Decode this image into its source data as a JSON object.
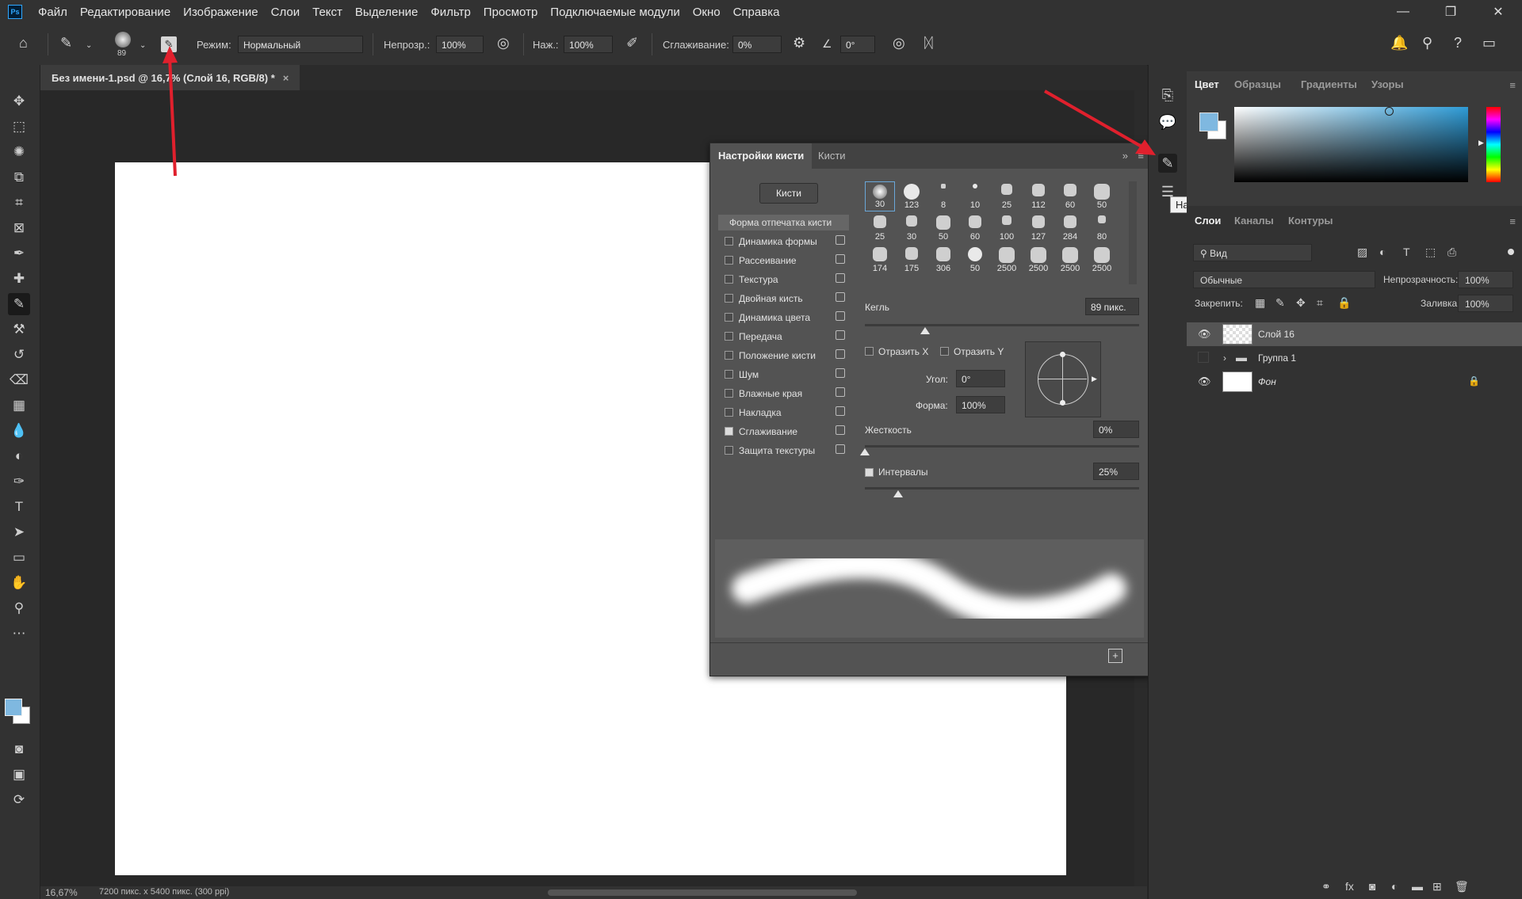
{
  "menubar": {
    "logo": "Ps",
    "items": [
      "Файл",
      "Редактирование",
      "Изображение",
      "Слои",
      "Текст",
      "Выделение",
      "Фильтр",
      "Просмотр",
      "Подключаемые модули",
      "Окно",
      "Справка"
    ],
    "minimize": "—",
    "restore": "❐",
    "close": "✕"
  },
  "options": {
    "brush_size": "89",
    "mode_label": "Режим:",
    "mode_value": "Нормальный",
    "opacity_label": "Непрозр.:",
    "opacity_value": "100%",
    "pressure_label": "Наж.:",
    "pressure_value": "100%",
    "smoothing_label": "Сглаживание:",
    "smoothing_value": "0%",
    "angle_value": "0°"
  },
  "document": {
    "tab_title": "Без имени-1.psd @ 16,7% (Слой 16, RGB/8) *",
    "zoom": "16,67%",
    "info": "7200 пикс. x 5400 пикс. (300 ppi)"
  },
  "brush_panel": {
    "tab_settings": "Настройки кисти",
    "tab_brushes": "Кисти",
    "brushes_button": "Кисти",
    "items": [
      {
        "label": "Форма отпечатка кисти",
        "checked": false,
        "header": true
      },
      {
        "label": "Динамика формы",
        "checked": false
      },
      {
        "label": "Рассеивание",
        "checked": false
      },
      {
        "label": "Текстура",
        "checked": false
      },
      {
        "label": "Двойная кисть",
        "checked": false
      },
      {
        "label": "Динамика цвета",
        "checked": false
      },
      {
        "label": "Передача",
        "checked": false
      },
      {
        "label": "Положение кисти",
        "checked": false
      },
      {
        "label": "Шум",
        "checked": false
      },
      {
        "label": "Влажные края",
        "checked": false
      },
      {
        "label": "Накладка",
        "checked": false
      },
      {
        "label": "Сглаживание",
        "checked": true
      },
      {
        "label": "Защита текстуры",
        "checked": false
      }
    ],
    "tips": [
      "30",
      "123",
      "8",
      "10",
      "25",
      "112",
      "60",
      "50",
      "25",
      "30",
      "50",
      "60",
      "100",
      "127",
      "284",
      "80",
      "174",
      "175",
      "306",
      "50",
      "2500",
      "2500",
      "2500",
      "2500"
    ],
    "size_label": "Кегль",
    "size_value": "89 пикс.",
    "size_fraction": 0.22,
    "flip_x": "Отразить X",
    "flip_y": "Отразить Y",
    "angle_label": "Угол:",
    "angle_value": "0°",
    "roundness_label": "Форма:",
    "roundness_value": "100%",
    "hardness_label": "Жесткость",
    "hardness_value": "0%",
    "hardness_fraction": 0,
    "spacing_label": "Интервалы",
    "spacing_value": "25%",
    "spacing_fraction": 0.12,
    "spacing_checked": true
  },
  "tooltip": "Настройки кисти",
  "color_panel": {
    "tabs": [
      "Цвет",
      "Образцы",
      "Градиенты",
      "Узоры"
    ],
    "foreground": "#7fb8e0",
    "background": "#ffffff"
  },
  "layers_panel": {
    "tabs": [
      "Слои",
      "Каналы",
      "Контуры"
    ],
    "filter_label": "Вид",
    "blend_mode": "Обычные",
    "opacity_label": "Непрозрачность:",
    "opacity_value": "100%",
    "lock_label": "Закрепить:",
    "fill_label": "Заливка:",
    "fill_value": "100%",
    "layers": [
      {
        "name": "Слой 16",
        "visible": true,
        "selected": true
      },
      {
        "name": "Группа 1",
        "visible": false,
        "selected": false
      },
      {
        "name": "Фон",
        "visible": true,
        "selected": false
      }
    ]
  }
}
